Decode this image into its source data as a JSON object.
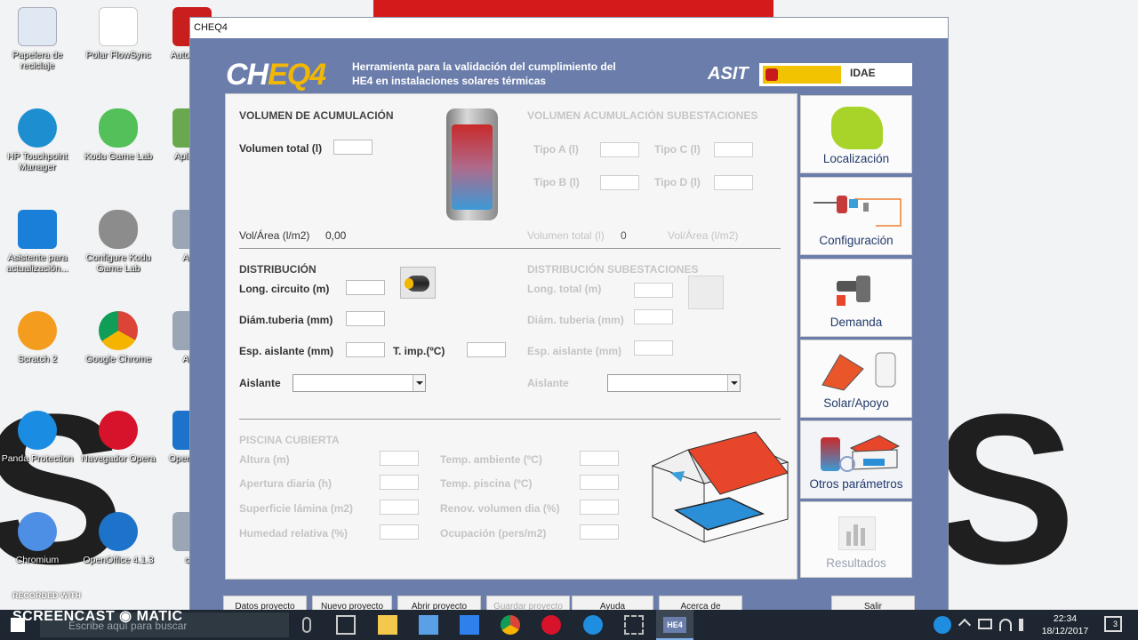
{
  "desktop": {
    "icons": [
      {
        "label": "Papelera de reciclaje"
      },
      {
        "label": "Polar FlowSync"
      },
      {
        "label": "Auto Espa"
      },
      {
        "label": "HP Touchpoint Manager"
      },
      {
        "label": "Kodu Game Lab"
      },
      {
        "label": "Apli escr"
      },
      {
        "label": "Asistente para actualización..."
      },
      {
        "label": "Configure Kodu Game Lab"
      },
      {
        "label": "Auto"
      },
      {
        "label": "Scratch 2"
      },
      {
        "label": "Google Chrome"
      },
      {
        "label": "ABC"
      },
      {
        "label": "Panda Protection"
      },
      {
        "label": "Navegador Opera"
      },
      {
        "label": "Open (es) I"
      },
      {
        "label": "Chromium"
      },
      {
        "label": "OpenOffice 4.1.3"
      },
      {
        "label": "cas"
      }
    ]
  },
  "window": {
    "title": "CHEQ4",
    "logo_part1": "CH",
    "logo_part2": "EQ4",
    "subtitle": "Herramienta para la validación del cumplimiento del HE4 en instalaciones solares térmicas",
    "asit": "ASIT",
    "idae": "IDAE"
  },
  "acumulacion": {
    "title": "VOLUMEN DE ACUMULACIÓN",
    "volumen_total_label": "Volumen total (l)",
    "vol_area_label": "Vol/Área (l/m2)",
    "vol_area_value": "0,00"
  },
  "subestaciones": {
    "title": "VOLUMEN ACUMULACIÓN SUBESTACIONES",
    "tipo_a": "Tipo A (l)",
    "tipo_b": "Tipo B (l)",
    "tipo_c": "Tipo C (l)",
    "tipo_d": "Tipo D (l)",
    "volumen_total_label": "Volumen total (l)",
    "volumen_total_value": "0",
    "vol_area_label": "Vol/Área (l/m2)"
  },
  "distribucion": {
    "title": "DISTRIBUCIÓN",
    "long_circuito": "Long. circuito (m)",
    "diam_tuberia": "Diám.tuberia (mm)",
    "esp_aislante": "Esp. aislante (mm)",
    "t_imp": "T. imp.(ºC)",
    "aislante": "Aislante"
  },
  "distribucion_sub": {
    "title": "DISTRIBUCIÓN SUBESTACIONES",
    "long_total": "Long. total (m)",
    "diam_tuberia": "Diám. tuberia (mm)",
    "esp_aislante": "Esp. aislante (mm)",
    "aislante": "Aislante"
  },
  "piscina": {
    "title": "PISCINA CUBIERTA",
    "altura": "Altura (m)",
    "apertura": "Apertura diaria (h)",
    "superficie": "Superficie lámina (m2)",
    "humedad": "Humedad relativa (%)",
    "temp_ambiente": "Temp. ambiente (ºC)",
    "temp_piscina": "Temp. piscina (ºC)",
    "renov": "Renov. volumen dia (%)",
    "ocupacion": "Ocupación (pers/m2)"
  },
  "nav": {
    "localizacion": "Localización",
    "configuracion": "Configuración",
    "demanda": "Demanda",
    "solar": "Solar/Apoyo",
    "otros": "Otros parámetros",
    "resultados": "Resultados"
  },
  "buttons": {
    "datos": "Datos proyecto",
    "nuevo": "Nuevo proyecto",
    "abrir": "Abrir proyecto",
    "guardar": "Guardar proyecto",
    "ayuda": "Ayuda",
    "acerca": "Acerca de",
    "salir": "Salir"
  },
  "taskbar": {
    "search_placeholder": "Escribe aquí para buscar",
    "time": "22:34",
    "date": "18/12/2017",
    "notif_count": "3",
    "he4": "HE4"
  },
  "screencast": {
    "recorded": "RECORDED WITH",
    "name": "SCREENCAST ◉ MATIC"
  },
  "colors": {
    "window_bg": "#6b7eab",
    "accent_yellow": "#f2b705",
    "nav_text": "#223a6a"
  }
}
